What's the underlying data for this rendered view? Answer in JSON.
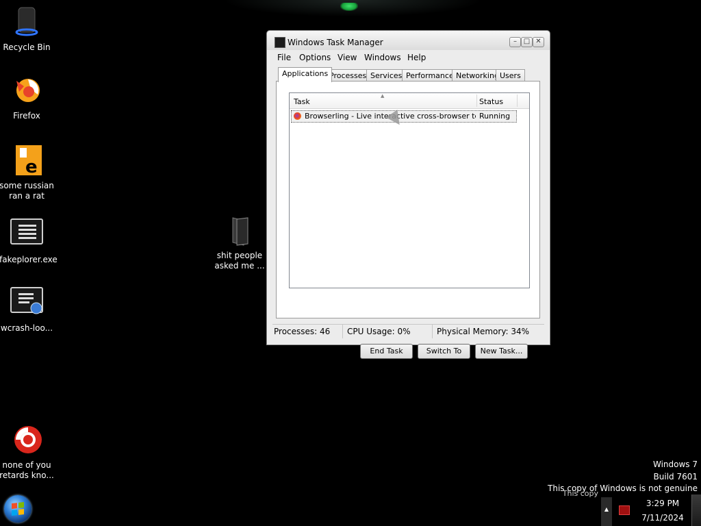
{
  "desktop": {
    "icons": [
      {
        "label": "Recycle Bin"
      },
      {
        "label": "Firefox"
      },
      {
        "label": "some russian\nran a rat"
      },
      {
        "label": "fakeplorer.exe"
      },
      {
        "label": "wcrash-loo..."
      },
      {
        "label": "none of you\nretards kno..."
      },
      {
        "label": "shit people\nasked me ..."
      }
    ]
  },
  "taskmanager": {
    "title": "Windows Task Manager",
    "window_buttons": {
      "minimize": "–",
      "maximize": "□",
      "close": "✕"
    },
    "menu": [
      "File",
      "Options",
      "View",
      "Windows",
      "Help"
    ],
    "tabs": [
      "Applications",
      "Processes",
      "Services",
      "Performance",
      "Networking",
      "Users"
    ],
    "active_tab": "Applications",
    "columns": {
      "task": "Task",
      "status": "Status"
    },
    "rows": [
      {
        "task": "Browserling - Live interactive cross-browser testi...",
        "status": "Running"
      }
    ],
    "buttons": {
      "end_task": "End Task",
      "switch_to": "Switch To",
      "new_task": "New Task..."
    },
    "statusbar": {
      "processes": "Processes: 46",
      "cpu": "CPU Usage: 0%",
      "memory": "Physical Memory: 34%"
    }
  },
  "watermark": {
    "line1": "Windows 7",
    "line2": "Build 7601",
    "line3": "This copy of Windows is not genuine",
    "ghost": "This copy"
  },
  "taskbar": {
    "time": "3:29 PM",
    "date": "7/11/2024",
    "tray_arrow": "▲"
  },
  "colors": {
    "desktop_bg": "#000000",
    "window_bg": "#ececec",
    "text_on_desktop": "#ffffff"
  },
  "icons": {
    "recycle_bin": "recycle-bin-icon",
    "firefox": "firefox-icon",
    "rat_file": "java-file-icon",
    "fakeplorer": "application-icon",
    "wcrash": "application-globe-icon",
    "none_of_you": "chrome-like-icon",
    "folder": "folder-icon",
    "start": "windows-orb-icon"
  }
}
